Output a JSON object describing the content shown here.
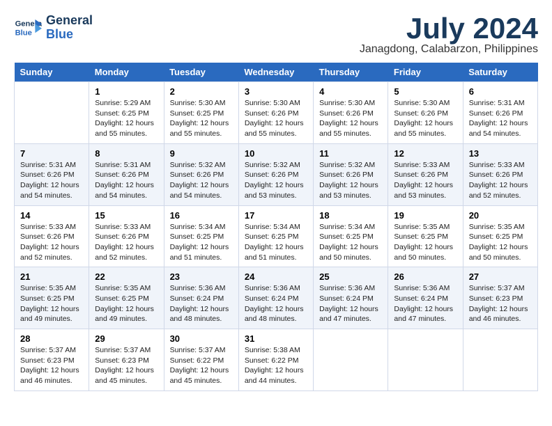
{
  "header": {
    "logo_line1": "General",
    "logo_line2": "Blue",
    "month": "July 2024",
    "location": "Janagdong, Calabarzon, Philippines"
  },
  "days_of_week": [
    "Sunday",
    "Monday",
    "Tuesday",
    "Wednesday",
    "Thursday",
    "Friday",
    "Saturday"
  ],
  "weeks": [
    [
      {
        "day": "",
        "info": ""
      },
      {
        "day": "1",
        "info": "Sunrise: 5:29 AM\nSunset: 6:25 PM\nDaylight: 12 hours\nand 55 minutes."
      },
      {
        "day": "2",
        "info": "Sunrise: 5:30 AM\nSunset: 6:25 PM\nDaylight: 12 hours\nand 55 minutes."
      },
      {
        "day": "3",
        "info": "Sunrise: 5:30 AM\nSunset: 6:26 PM\nDaylight: 12 hours\nand 55 minutes."
      },
      {
        "day": "4",
        "info": "Sunrise: 5:30 AM\nSunset: 6:26 PM\nDaylight: 12 hours\nand 55 minutes."
      },
      {
        "day": "5",
        "info": "Sunrise: 5:30 AM\nSunset: 6:26 PM\nDaylight: 12 hours\nand 55 minutes."
      },
      {
        "day": "6",
        "info": "Sunrise: 5:31 AM\nSunset: 6:26 PM\nDaylight: 12 hours\nand 54 minutes."
      }
    ],
    [
      {
        "day": "7",
        "info": "Sunrise: 5:31 AM\nSunset: 6:26 PM\nDaylight: 12 hours\nand 54 minutes."
      },
      {
        "day": "8",
        "info": "Sunrise: 5:31 AM\nSunset: 6:26 PM\nDaylight: 12 hours\nand 54 minutes."
      },
      {
        "day": "9",
        "info": "Sunrise: 5:32 AM\nSunset: 6:26 PM\nDaylight: 12 hours\nand 54 minutes."
      },
      {
        "day": "10",
        "info": "Sunrise: 5:32 AM\nSunset: 6:26 PM\nDaylight: 12 hours\nand 53 minutes."
      },
      {
        "day": "11",
        "info": "Sunrise: 5:32 AM\nSunset: 6:26 PM\nDaylight: 12 hours\nand 53 minutes."
      },
      {
        "day": "12",
        "info": "Sunrise: 5:33 AM\nSunset: 6:26 PM\nDaylight: 12 hours\nand 53 minutes."
      },
      {
        "day": "13",
        "info": "Sunrise: 5:33 AM\nSunset: 6:26 PM\nDaylight: 12 hours\nand 52 minutes."
      }
    ],
    [
      {
        "day": "14",
        "info": "Sunrise: 5:33 AM\nSunset: 6:26 PM\nDaylight: 12 hours\nand 52 minutes."
      },
      {
        "day": "15",
        "info": "Sunrise: 5:33 AM\nSunset: 6:26 PM\nDaylight: 12 hours\nand 52 minutes."
      },
      {
        "day": "16",
        "info": "Sunrise: 5:34 AM\nSunset: 6:25 PM\nDaylight: 12 hours\nand 51 minutes."
      },
      {
        "day": "17",
        "info": "Sunrise: 5:34 AM\nSunset: 6:25 PM\nDaylight: 12 hours\nand 51 minutes."
      },
      {
        "day": "18",
        "info": "Sunrise: 5:34 AM\nSunset: 6:25 PM\nDaylight: 12 hours\nand 50 minutes."
      },
      {
        "day": "19",
        "info": "Sunrise: 5:35 AM\nSunset: 6:25 PM\nDaylight: 12 hours\nand 50 minutes."
      },
      {
        "day": "20",
        "info": "Sunrise: 5:35 AM\nSunset: 6:25 PM\nDaylight: 12 hours\nand 50 minutes."
      }
    ],
    [
      {
        "day": "21",
        "info": "Sunrise: 5:35 AM\nSunset: 6:25 PM\nDaylight: 12 hours\nand 49 minutes."
      },
      {
        "day": "22",
        "info": "Sunrise: 5:35 AM\nSunset: 6:25 PM\nDaylight: 12 hours\nand 49 minutes."
      },
      {
        "day": "23",
        "info": "Sunrise: 5:36 AM\nSunset: 6:24 PM\nDaylight: 12 hours\nand 48 minutes."
      },
      {
        "day": "24",
        "info": "Sunrise: 5:36 AM\nSunset: 6:24 PM\nDaylight: 12 hours\nand 48 minutes."
      },
      {
        "day": "25",
        "info": "Sunrise: 5:36 AM\nSunset: 6:24 PM\nDaylight: 12 hours\nand 47 minutes."
      },
      {
        "day": "26",
        "info": "Sunrise: 5:36 AM\nSunset: 6:24 PM\nDaylight: 12 hours\nand 47 minutes."
      },
      {
        "day": "27",
        "info": "Sunrise: 5:37 AM\nSunset: 6:23 PM\nDaylight: 12 hours\nand 46 minutes."
      }
    ],
    [
      {
        "day": "28",
        "info": "Sunrise: 5:37 AM\nSunset: 6:23 PM\nDaylight: 12 hours\nand 46 minutes."
      },
      {
        "day": "29",
        "info": "Sunrise: 5:37 AM\nSunset: 6:23 PM\nDaylight: 12 hours\nand 45 minutes."
      },
      {
        "day": "30",
        "info": "Sunrise: 5:37 AM\nSunset: 6:22 PM\nDaylight: 12 hours\nand 45 minutes."
      },
      {
        "day": "31",
        "info": "Sunrise: 5:38 AM\nSunset: 6:22 PM\nDaylight: 12 hours\nand 44 minutes."
      },
      {
        "day": "",
        "info": ""
      },
      {
        "day": "",
        "info": ""
      },
      {
        "day": "",
        "info": ""
      }
    ]
  ]
}
